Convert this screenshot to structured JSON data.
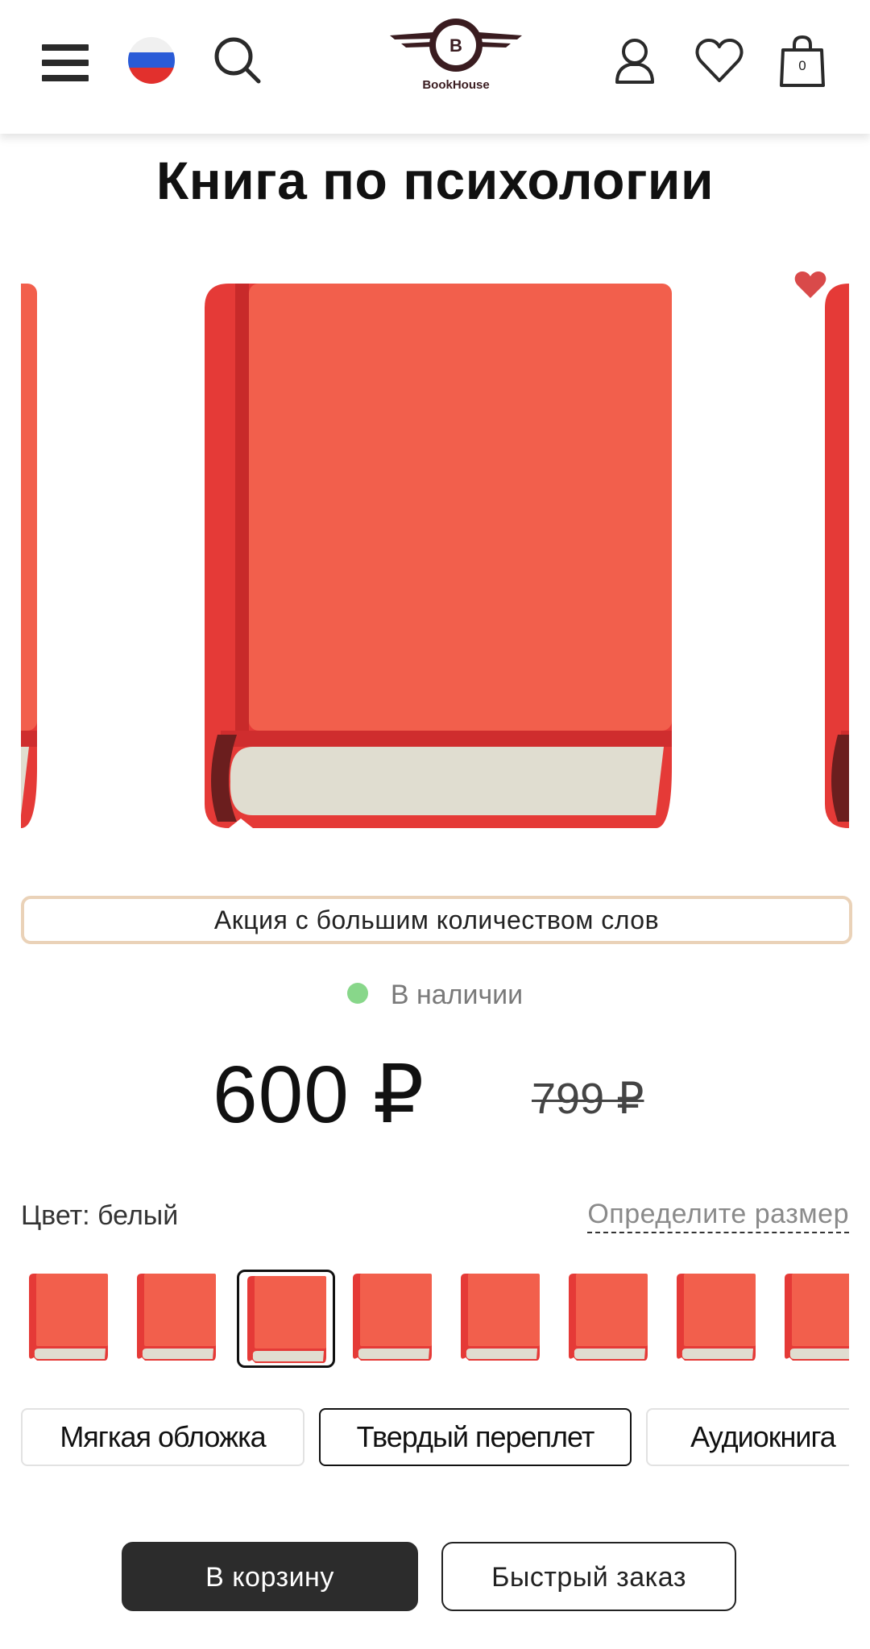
{
  "header": {
    "logo_letter": "B",
    "logo_text": "BookHouse",
    "cart_count": "0"
  },
  "product": {
    "title": "Книга по психологии",
    "promo": "Акция с большим количеством слов",
    "stock": "В наличии",
    "price": "600 ₽",
    "old_price": "799 ₽"
  },
  "options": {
    "color_label": "Цвет: белый",
    "size_link": "Определите размер",
    "selected_swatch_index": 2,
    "formats": [
      "Мягкая обложка",
      "Твердый переплет",
      "Аудиокнига"
    ],
    "selected_format": "Твердый переплет"
  },
  "actions": {
    "add_to_cart": "В корзину",
    "quick_order": "Быстрый заказ"
  },
  "colors": {
    "book_cover": "#f25f4c",
    "book_spine": "#e53a37",
    "pages": "#e0ddd0",
    "stock_dot": "#88d78a",
    "promo_border": "#ead2b8",
    "primary_button": "#2c2c2c",
    "logo": "#3a1c20"
  },
  "icons": [
    "menu-icon",
    "russia-flag-icon",
    "search-icon",
    "user-icon",
    "heart-icon",
    "cart-icon",
    "favorite-heart-icon"
  ]
}
